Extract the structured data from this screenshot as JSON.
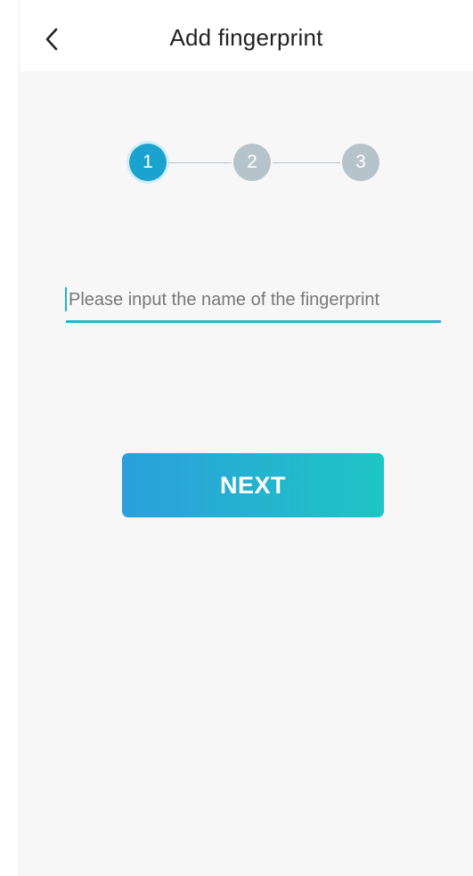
{
  "header": {
    "title": "Add fingerprint",
    "back_icon": "chevron-left-icon"
  },
  "stepper": {
    "steps": [
      {
        "label": "1",
        "state": "active"
      },
      {
        "label": "2",
        "state": "inactive"
      },
      {
        "label": "3",
        "state": "inactive"
      }
    ],
    "current_step": 1
  },
  "form": {
    "name_value": "",
    "name_placeholder": "Please input the name of the fingerprint"
  },
  "actions": {
    "next_label": "NEXT"
  },
  "colors": {
    "accent": "#1ba3cf",
    "inactive_step": "#b6c3cb",
    "underline": "#23b7cf",
    "button_gradient_start": "#2b9fdc",
    "button_gradient_end": "#1ec6c4",
    "background": "#f7f7f7"
  }
}
